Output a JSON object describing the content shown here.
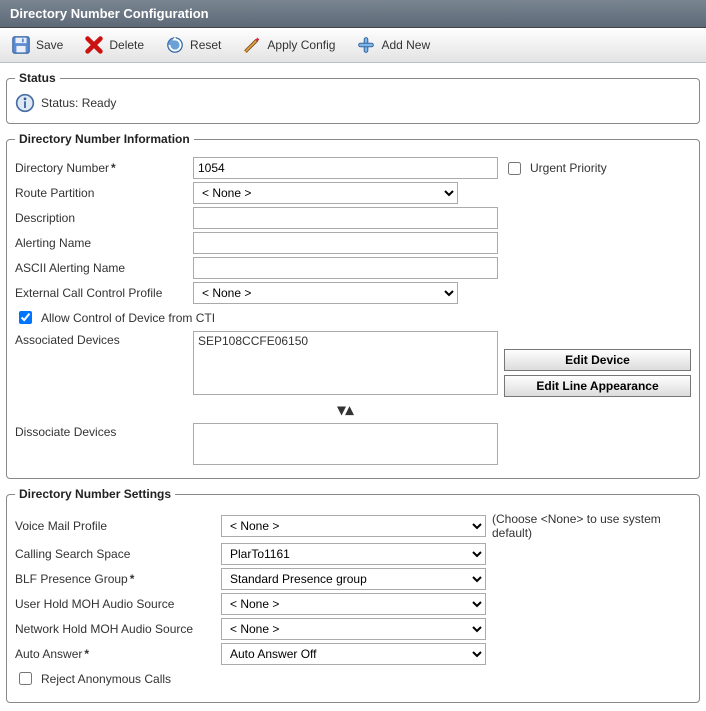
{
  "title": "Directory Number Configuration",
  "toolbar": {
    "save": "Save",
    "delete": "Delete",
    "reset": "Reset",
    "apply": "Apply Config",
    "add": "Add New"
  },
  "status": {
    "legend": "Status",
    "text": "Status: Ready"
  },
  "info": {
    "legend": "Directory Number Information",
    "labels": {
      "dn": "Directory Number",
      "route": "Route Partition",
      "desc": "Description",
      "alert": "Alerting Name",
      "ascii": "ASCII Alerting Name",
      "ext": "External Call Control Profile",
      "allow": "Allow Control of Device from CTI",
      "assoc": "Associated Devices",
      "dissoc": "Dissociate Devices",
      "urgent": "Urgent Priority"
    },
    "values": {
      "dn": "1054",
      "route": "< None >",
      "desc": "",
      "alert": "",
      "ascii": "",
      "ext": "< None >",
      "assoc": "SEP108CCFE06150"
    },
    "buttons": {
      "edit_device": "Edit Device",
      "edit_line": "Edit Line Appearance"
    }
  },
  "settings": {
    "legend": "Directory Number Settings",
    "labels": {
      "vmp": "Voice Mail Profile",
      "css": "Calling Search Space",
      "blf": "BLF Presence Group",
      "uhold": "User Hold MOH Audio Source",
      "nhold": "Network Hold MOH Audio Source",
      "auto": "Auto Answer",
      "reject": "Reject Anonymous Calls"
    },
    "values": {
      "vmp": "< None >",
      "css": "PlarTo1161",
      "blf": "Standard Presence group",
      "uhold": "< None >",
      "nhold": "< None >",
      "auto": "Auto Answer Off"
    },
    "hint": "(Choose <None> to use system default)"
  }
}
